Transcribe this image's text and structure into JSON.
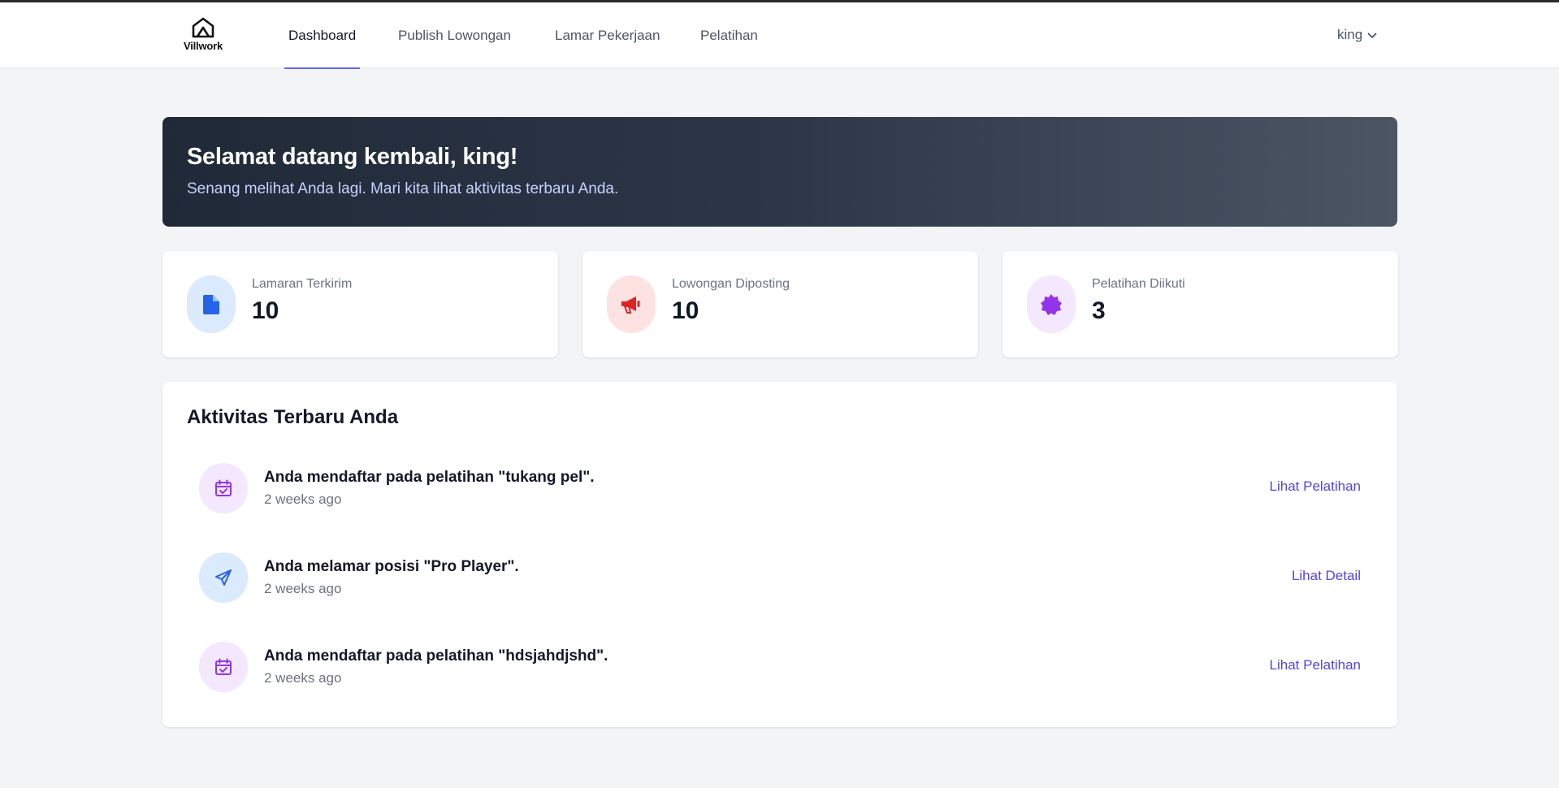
{
  "brand": {
    "name": "Villwork"
  },
  "nav": {
    "items": [
      {
        "label": "Dashboard",
        "active": true
      },
      {
        "label": "Publish Lowongan",
        "active": false
      },
      {
        "label": "Lamar Pekerjaan",
        "active": false
      },
      {
        "label": "Pelatihan",
        "active": false
      }
    ],
    "user": {
      "name": "king",
      "icon": "chevron-down-icon"
    }
  },
  "banner": {
    "title": "Selamat datang kembali, king!",
    "subtitle": "Senang melihat Anda lagi. Mari kita lihat aktivitas terbaru Anda."
  },
  "stats": [
    {
      "label": "Lamaran Terkirim",
      "value": "10",
      "icon": "document-icon",
      "color": "#2563eb",
      "bg": "#dbeafe"
    },
    {
      "label": "Lowongan Diposting",
      "value": "10",
      "icon": "megaphone-icon",
      "color": "#dc2626",
      "bg": "#fee2e2"
    },
    {
      "label": "Pelatihan Diikuti",
      "value": "3",
      "icon": "badge-icon",
      "color": "#9333ea",
      "bg": "#f3e8ff"
    }
  ],
  "activity": {
    "title": "Aktivitas Terbaru Anda",
    "items": [
      {
        "text": "Anda mendaftar pada pelatihan \"tukang pel\".",
        "time": "2 weeks ago",
        "link": "Lihat Pelatihan",
        "icon": "calendar-check-icon"
      },
      {
        "text": "Anda melamar posisi \"Pro Player\".",
        "time": "2 weeks ago",
        "link": "Lihat Detail",
        "icon": "paper-plane-icon"
      },
      {
        "text": "Anda mendaftar pada pelatihan \"hdsjahdjshd\".",
        "time": "2 weeks ago",
        "link": "Lihat Pelatihan",
        "icon": "calendar-check-icon"
      }
    ]
  },
  "colors": {
    "accent": "#6366f1",
    "link": "#4f46e5",
    "page_bg": "#f3f4f6"
  }
}
